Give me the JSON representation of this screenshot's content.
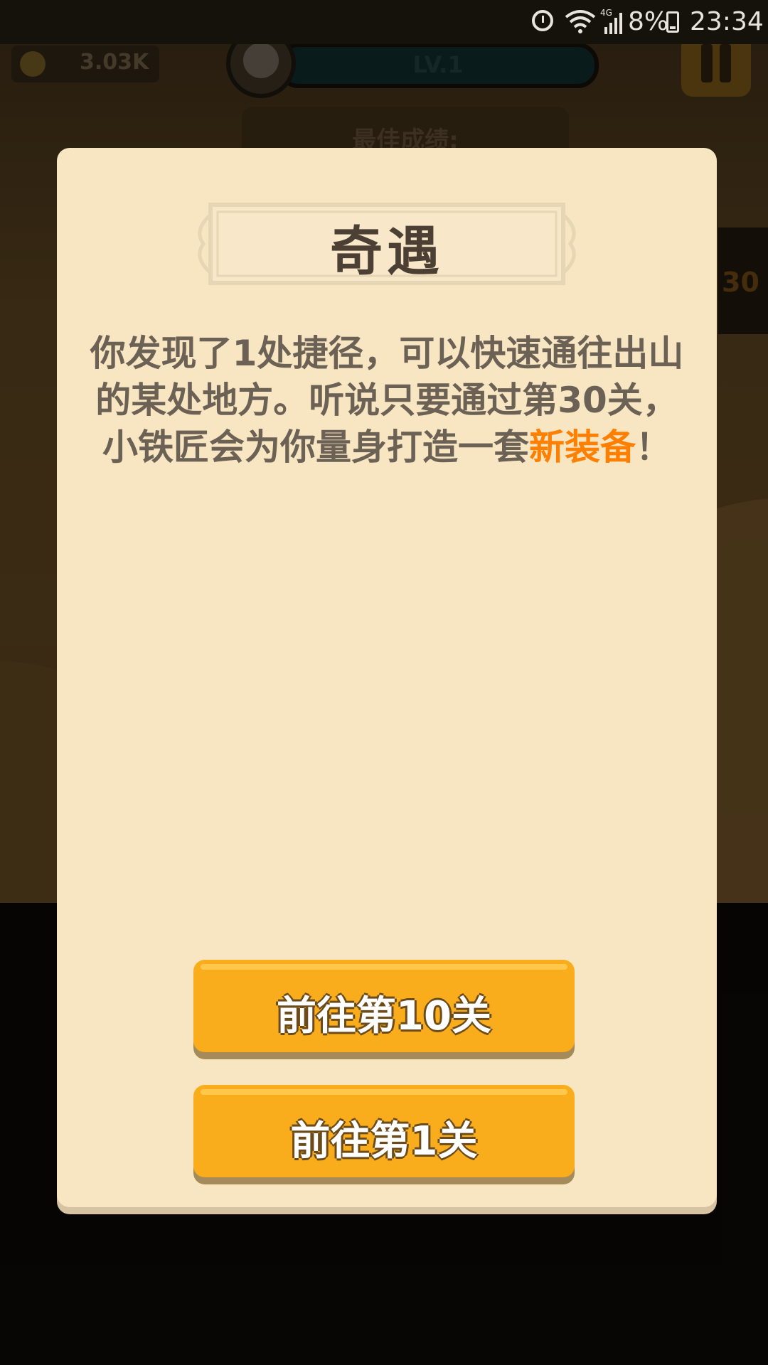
{
  "status_bar": {
    "battery": "8%",
    "time": "23:34",
    "network": "4G",
    "icons": [
      "alarm-icon",
      "wifi-icon",
      "signal-icon",
      "battery-icon"
    ]
  },
  "hud": {
    "coins": "3.03K",
    "level": "LV.1",
    "best_score_label": "最佳成绩:",
    "side_number": "30"
  },
  "dialog": {
    "title": "奇遇",
    "body_before": "你发现了1处捷径，可以快速通往出山的某处地方。听说只要通过第30关，小铁匠会为你量身打造一套",
    "body_highlight": "新装备",
    "body_after": "！",
    "buttons": [
      {
        "label": "前往第10关"
      },
      {
        "label": "前往第1关"
      }
    ]
  },
  "colors": {
    "dialog_bg": "#f8e6c3",
    "button": "#f9ad1c",
    "highlight": "#ff7f00",
    "text": "#6c6155"
  }
}
